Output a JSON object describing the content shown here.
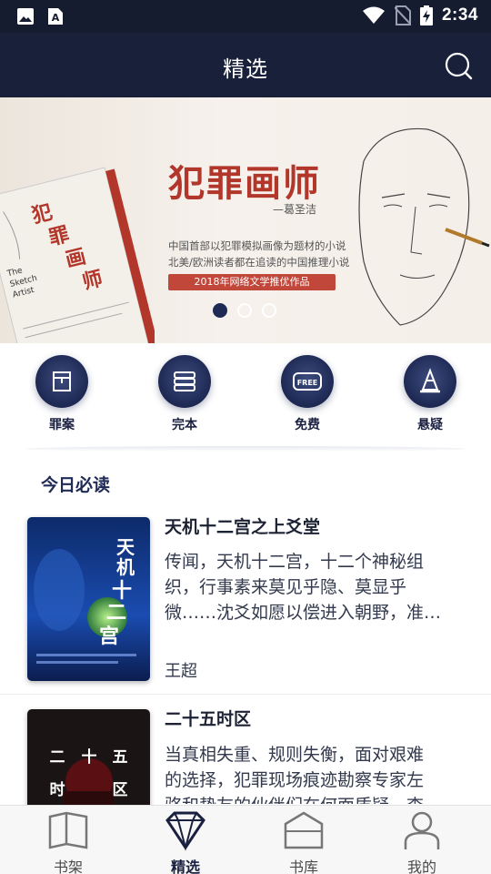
{
  "status_bar": {
    "time": "2:34",
    "icons": [
      "image-icon",
      "a-icon",
      "wifi-icon",
      "no-sim-icon",
      "battery-charging-icon"
    ]
  },
  "header": {
    "title": "精选",
    "search_icon": "search-icon"
  },
  "banner": {
    "title": "犯罪画师",
    "author": "—葛圣洁",
    "line1": "中国首部以犯罪模拟画像为题材的小说",
    "line2": "北美/欧洲读者都在追读的中国推理小说",
    "tag": "2018年网络文学推优作品",
    "book_cover_title": "犯罪画师",
    "book_cover_en": "The Sketch Artist",
    "dots": 3,
    "active_dot": 0
  },
  "categories": [
    {
      "label": "罪案",
      "icon": "case-file-icon"
    },
    {
      "label": "完本",
      "icon": "book-stack-icon"
    },
    {
      "label": "免费",
      "icon": "free-badge-icon"
    },
    {
      "label": "悬疑",
      "icon": "traffic-cone-icon"
    }
  ],
  "section": {
    "title": "今日必读"
  },
  "books": [
    {
      "title": "天机十二宫之上爻堂",
      "desc": "传闻，天机十二宫，十二个神秘组织，行事素来莫见乎隐、莫显乎微……沈爻如愿以偿进入朝野，准…",
      "desc_lines": [
        "传闻，天机十二宫，十二个神秘组",
        "织，行事素来莫见乎隐、莫显乎",
        "微……沈爻如愿以偿进入朝野，准…"
      ],
      "author": "王超",
      "cover_text": "天机十二宫"
    },
    {
      "title": "二十五时区",
      "desc_lines": [
        "当真相失重、规则失衡，面对艰难",
        "的选择，犯罪现场痕迹勘察专家左",
        "骆和挚友的伙伴们在何面质疑，查"
      ],
      "cover_text": [
        "二",
        "十",
        "五",
        "时",
        "区"
      ]
    }
  ],
  "bottom_nav": [
    {
      "label": "书架",
      "icon": "bookshelf-icon",
      "active": false
    },
    {
      "label": "精选",
      "icon": "diamond-icon",
      "active": true
    },
    {
      "label": "书库",
      "icon": "library-bag-icon",
      "active": false
    },
    {
      "label": "我的",
      "icon": "profile-icon",
      "active": false
    }
  ],
  "colors": {
    "header_bg": "#19203a",
    "accent": "#1f2a55",
    "banner_red": "#b2372a"
  }
}
